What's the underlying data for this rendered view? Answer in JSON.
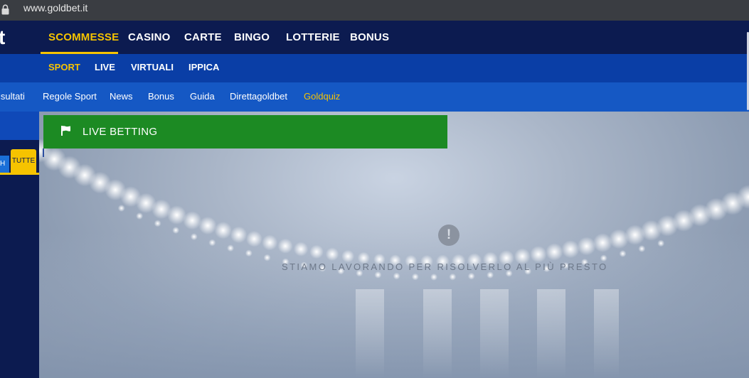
{
  "browser": {
    "url": "www.goldbet.it"
  },
  "logo": {
    "fragment": "t"
  },
  "main_nav": {
    "tabs": [
      {
        "label": "SCOMMESSE",
        "active": true
      },
      {
        "label": "CASINO"
      },
      {
        "label": "CARTE"
      },
      {
        "label": "BINGO"
      },
      {
        "label": "LOTTERIE"
      },
      {
        "label": "BONUS"
      }
    ]
  },
  "sub_nav": {
    "tabs": [
      {
        "label": "SPORT",
        "active": true
      },
      {
        "label": "LIVE"
      },
      {
        "label": "VIRTUALI"
      },
      {
        "label": "IPPICA"
      }
    ]
  },
  "links": [
    {
      "label": "isultati"
    },
    {
      "label": "Regole Sport"
    },
    {
      "label": "News"
    },
    {
      "label": "Bonus"
    },
    {
      "label": "Guida"
    },
    {
      "label": "Direttagoldbet"
    },
    {
      "label": "Goldquiz",
      "highlight": true
    }
  ],
  "sidebar": {
    "filter_partial": "H",
    "filter_all": "TUTTE"
  },
  "live_section": {
    "title": "LIVE BETTING",
    "icon": "flag-icon"
  },
  "error": {
    "icon": "exclamation-icon",
    "icon_glyph": "!",
    "message": "STIAMO LAVORANDO PER RISOLVERLO AL PIÙ PRESTO"
  },
  "colors": {
    "nav_dark": "#0c1b50",
    "accent_gold": "#f6c300",
    "subnav_blue": "#0a3ea6",
    "links_blue": "#1558c4",
    "live_green": "#1c8a23"
  }
}
